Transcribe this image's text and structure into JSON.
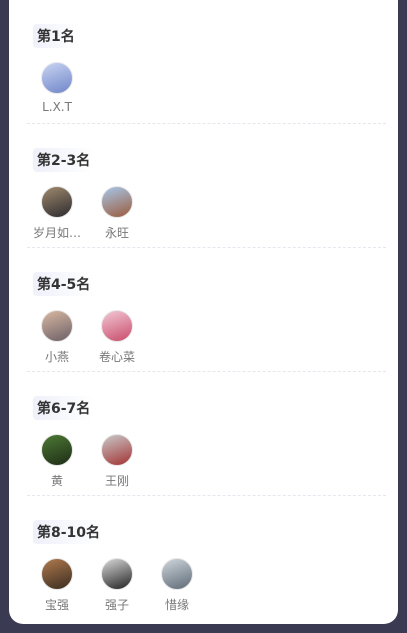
{
  "sections": [
    {
      "title": "第1名",
      "people": [
        {
          "name": "L.X.T",
          "avatar_colors": [
            "#c9d4f3",
            "#6f86c8"
          ]
        }
      ]
    },
    {
      "title": "第2-3名",
      "people": [
        {
          "name": "岁月如…",
          "avatar_colors": [
            "#a08a6d",
            "#2c2a2f"
          ]
        },
        {
          "name": "永旺",
          "avatar_colors": [
            "#a7c7ea",
            "#9b5b3b"
          ]
        }
      ]
    },
    {
      "title": "第4-5名",
      "people": [
        {
          "name": "小燕",
          "avatar_colors": [
            "#d9b9a3",
            "#6c5f66"
          ]
        },
        {
          "name": "卷心菜",
          "avatar_colors": [
            "#f2c9d6",
            "#c94b6a"
          ]
        }
      ]
    },
    {
      "title": "第6-7名",
      "people": [
        {
          "name": "黄",
          "avatar_colors": [
            "#4d7a34",
            "#1e2c17"
          ]
        },
        {
          "name": "王刚",
          "avatar_colors": [
            "#c9c9c9",
            "#a33232"
          ]
        }
      ]
    },
    {
      "title": "第8-10名",
      "people": [
        {
          "name": "宝强",
          "avatar_colors": [
            "#b07a4d",
            "#3a2c22"
          ]
        },
        {
          "name": "强子",
          "avatar_colors": [
            "#d9d9d9",
            "#222222"
          ]
        },
        {
          "name": "惜缘",
          "avatar_colors": [
            "#cfd6dd",
            "#5e6a76"
          ]
        }
      ]
    }
  ]
}
